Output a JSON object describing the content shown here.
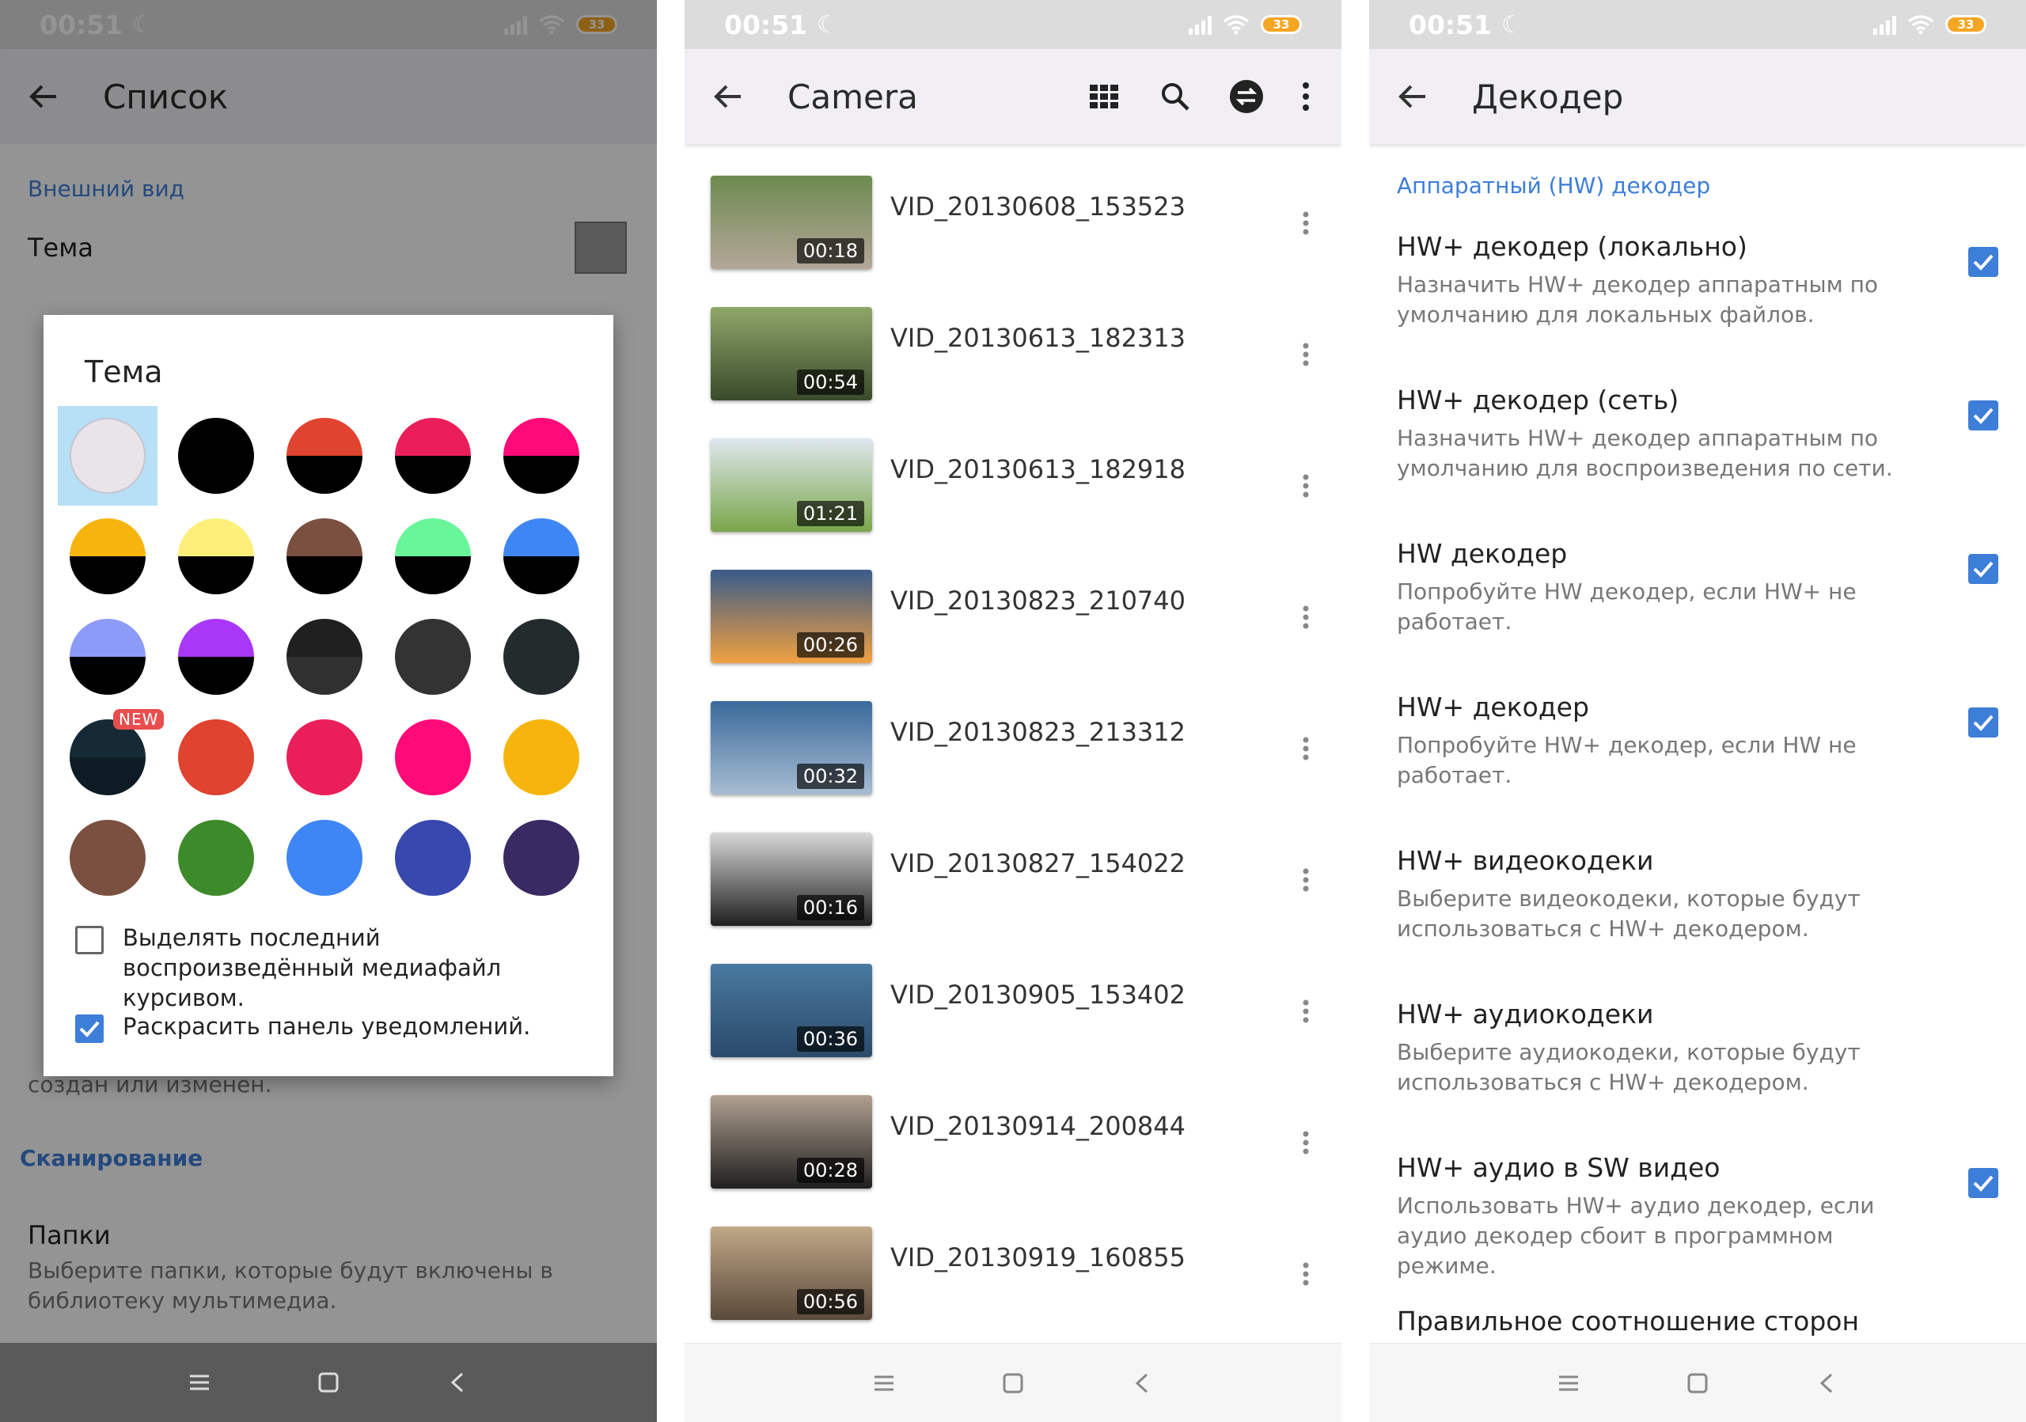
{
  "status": {
    "time": "00:51",
    "battery": "33"
  },
  "panel1": {
    "title": "Список",
    "section_appearance": "Внешний вид",
    "theme_label": "Тема",
    "section_scan": "Сканирование",
    "folders_title": "Папки",
    "folders_sub": "Выберите папки, которые будут включены в библиотеку мультимедиа.",
    "hidden_text": "создан или изменен.",
    "dialog": {
      "title": "Тема",
      "new_badge": "NEW",
      "checkbox_italic": "Выделять последний воспроизведённый медиафайл курсивом.",
      "checkbox_italic_checked": false,
      "checkbox_notif": "Раскрасить панель уведомлений.",
      "checkbox_notif_checked": true,
      "swatches": [
        {
          "top": "#e8e4ea",
          "bottom": "#e8e4ea"
        },
        {
          "top": "#000000",
          "bottom": "#000000"
        },
        {
          "top": "#e0432f",
          "bottom": "#000000"
        },
        {
          "top": "#ea1f5a",
          "bottom": "#000000"
        },
        {
          "top": "#ff0a78",
          "bottom": "#000000"
        },
        {
          "top": "#f7b40c",
          "bottom": "#000000"
        },
        {
          "top": "#fdf07a",
          "bottom": "#000000"
        },
        {
          "top": "#7a5040",
          "bottom": "#000000"
        },
        {
          "top": "#69f59a",
          "bottom": "#000000"
        },
        {
          "top": "#3f86f5",
          "bottom": "#000000"
        },
        {
          "top": "#8c9bf8",
          "bottom": "#000000"
        },
        {
          "top": "#a838f5",
          "bottom": "#000000"
        },
        {
          "top": "#202020",
          "bottom": "#303030"
        },
        {
          "top": "#333333",
          "bottom": "#333333"
        },
        {
          "top": "#232b2d",
          "bottom": "#232b2d"
        },
        {
          "top": "#162a35",
          "bottom": "#0d1c24"
        },
        {
          "top": "#e0432f",
          "bottom": "#e0432f"
        },
        {
          "top": "#ea1f5a",
          "bottom": "#ea1f5a"
        },
        {
          "top": "#ff0a78",
          "bottom": "#ff0a78"
        },
        {
          "top": "#f7b40c",
          "bottom": "#f7b40c"
        },
        {
          "top": "#7a5040",
          "bottom": "#7a5040"
        },
        {
          "top": "#3d8a2a",
          "bottom": "#3d8a2a"
        },
        {
          "top": "#3f86f5",
          "bottom": "#3f86f5"
        },
        {
          "top": "#3848ae",
          "bottom": "#3848ae"
        },
        {
          "top": "#3a2a63",
          "bottom": "#3a2a63"
        }
      ]
    }
  },
  "panel2": {
    "title": "Camera",
    "videos": [
      {
        "name": "VID_20130608_153523",
        "duration": "00:18",
        "c1": "#6d8a4e",
        "c2": "#b3a79a"
      },
      {
        "name": "VID_20130613_182313",
        "duration": "00:54",
        "c1": "#8fa66a",
        "c2": "#3a4a2a"
      },
      {
        "name": "VID_20130613_182918",
        "duration": "01:21",
        "c1": "#dfe7ef",
        "c2": "#7aa64a"
      },
      {
        "name": "VID_20130823_210740",
        "duration": "00:26",
        "c1": "#3a5b8a",
        "c2": "#f0a040"
      },
      {
        "name": "VID_20130823_213312",
        "duration": "00:32",
        "c1": "#3a6a9a",
        "c2": "#a7bcd2"
      },
      {
        "name": "VID_20130827_154022",
        "duration": "00:16",
        "c1": "#d8d8d8",
        "c2": "#202020"
      },
      {
        "name": "VID_20130905_153402",
        "duration": "00:36",
        "c1": "#4a7aa0",
        "c2": "#2a4a6a"
      },
      {
        "name": "VID_20130914_200844",
        "duration": "00:28",
        "c1": "#b0a090",
        "c2": "#202020"
      },
      {
        "name": "VID_20130919_160855",
        "duration": "00:56",
        "c1": "#c0a888",
        "c2": "#5a4a3a"
      }
    ]
  },
  "panel3": {
    "title": "Декодер",
    "section": "Аппаратный (HW) декодер",
    "items": [
      {
        "title": "HW+ декодер (локально)",
        "sub": "Назначить HW+ декодер аппаратным по умолчанию для локальных файлов.",
        "checked": true
      },
      {
        "title": "HW+ декодер (сеть)",
        "sub": "Назначить HW+ декодер аппаратным по умолчанию для воспроизведения по сети.",
        "checked": true
      },
      {
        "title": "HW декодер",
        "sub": "Попробуйте HW декодер, если HW+ не работает.",
        "checked": true
      },
      {
        "title": "HW+ декодер",
        "sub": "Попробуйте HW+ декодер, если HW не работает.",
        "checked": true
      },
      {
        "title": "HW+ видеокодеки",
        "sub": "Выберите видеокодеки, которые будут использоваться с HW+ декодером.",
        "checked": false
      },
      {
        "title": "HW+ аудиокодеки",
        "sub": "Выберите аудиокодеки, которые будут использоваться с HW+ декодером.",
        "checked": false
      },
      {
        "title": "HW+ аудио в SW видео",
        "sub": "Использовать HW+ аудио декодер, если аудио декодер сбоит в программном режиме.",
        "checked": true
      },
      {
        "title": "Правильное соотношение сторон",
        "sub": "",
        "checked": false
      }
    ]
  }
}
